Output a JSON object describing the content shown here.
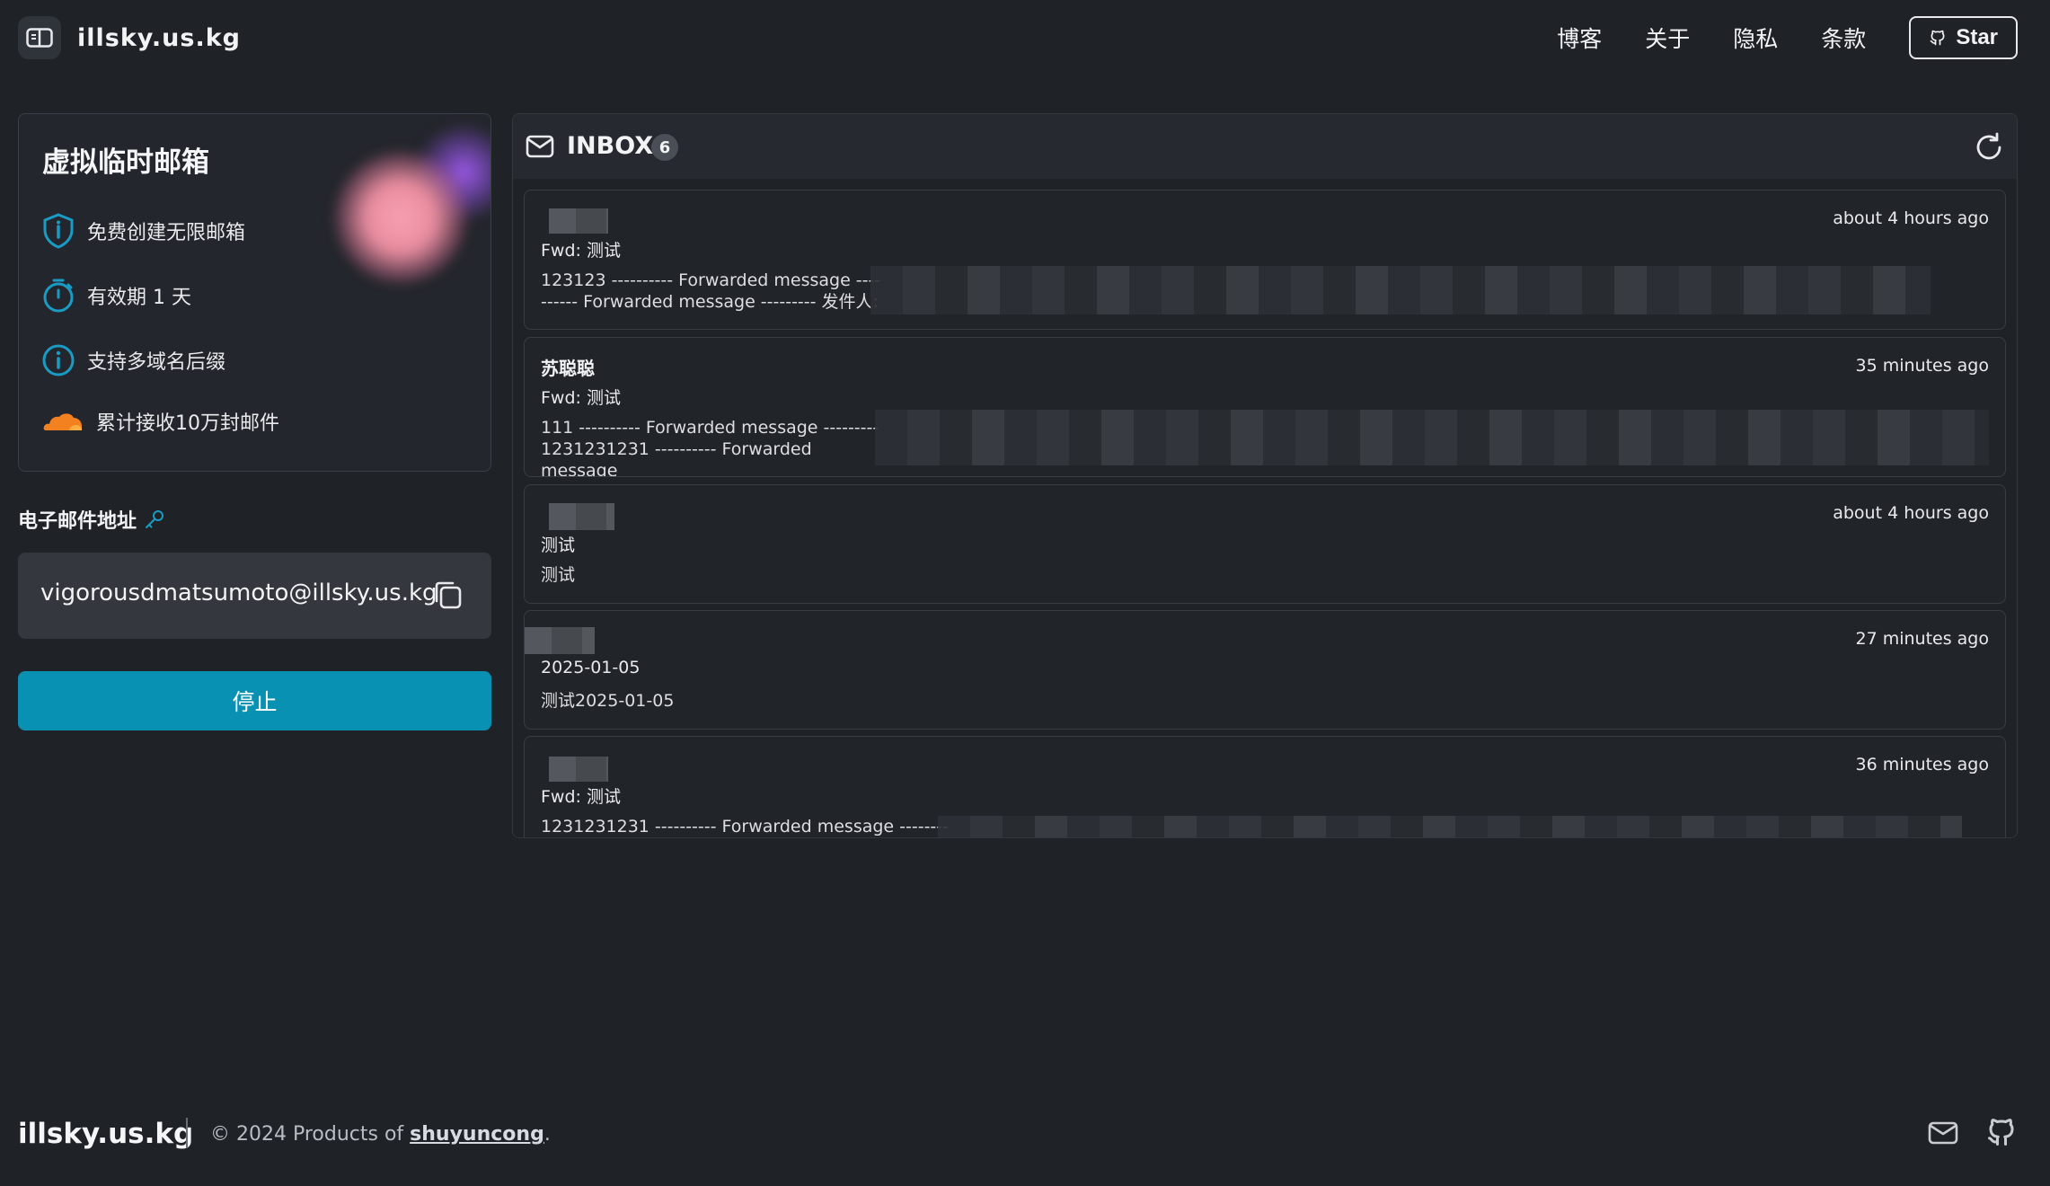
{
  "header": {
    "brand": "illsky.us.kg",
    "nav": [
      "博客",
      "关于",
      "隐私",
      "条款"
    ],
    "star_label": "Star"
  },
  "info_card": {
    "title": "虚拟临时邮箱",
    "features": [
      {
        "icon": "shield-icon",
        "label": "免费创建无限邮箱"
      },
      {
        "icon": "timer-icon",
        "label": "有效期 1 天"
      },
      {
        "icon": "info-icon",
        "label": "支持多域名后缀"
      },
      {
        "icon": "cloudflare-icon",
        "label": "累计接收10万封邮件"
      }
    ]
  },
  "email": {
    "label": "电子邮件地址",
    "address": "vigorousdmatsumoto@illsky.us.kg",
    "stop_label": "停止"
  },
  "inbox": {
    "title": "INBOX",
    "count": "6",
    "messages": [
      {
        "sender": "",
        "subject": "Fwd: 测试",
        "preview": "123123 ---------- Forwarded message ----\n------ Forwarded message --------- 发件人:",
        "time": "about 4 hours ago"
      },
      {
        "sender": "苏聪聪",
        "subject": "Fwd: 测试",
        "preview": "111 ---------- Forwarded message ---------\n1231231231 ---------- Forwarded message",
        "time": "35 minutes ago"
      },
      {
        "sender": "",
        "subject": "测试",
        "preview": "测试",
        "time": "about 4 hours ago"
      },
      {
        "sender": "",
        "subject": "2025-01-05",
        "preview": "测试2025-01-05",
        "time": "27 minutes ago"
      },
      {
        "sender": "",
        "subject": "Fwd: 测试",
        "preview": "1231231231 ---------- Forwarded message ---------",
        "time": "36 minutes ago"
      }
    ]
  },
  "footer": {
    "brand": "illsky.us.kg",
    "copyright_prefix": "© 2024 Products of ",
    "author": "shuyuncong",
    "copyright_suffix": "."
  },
  "colors": {
    "background": "#1f2227",
    "accent": "#0891b2",
    "icon_blue": "#1a9bc4",
    "cloud_orange": "#f48120"
  }
}
